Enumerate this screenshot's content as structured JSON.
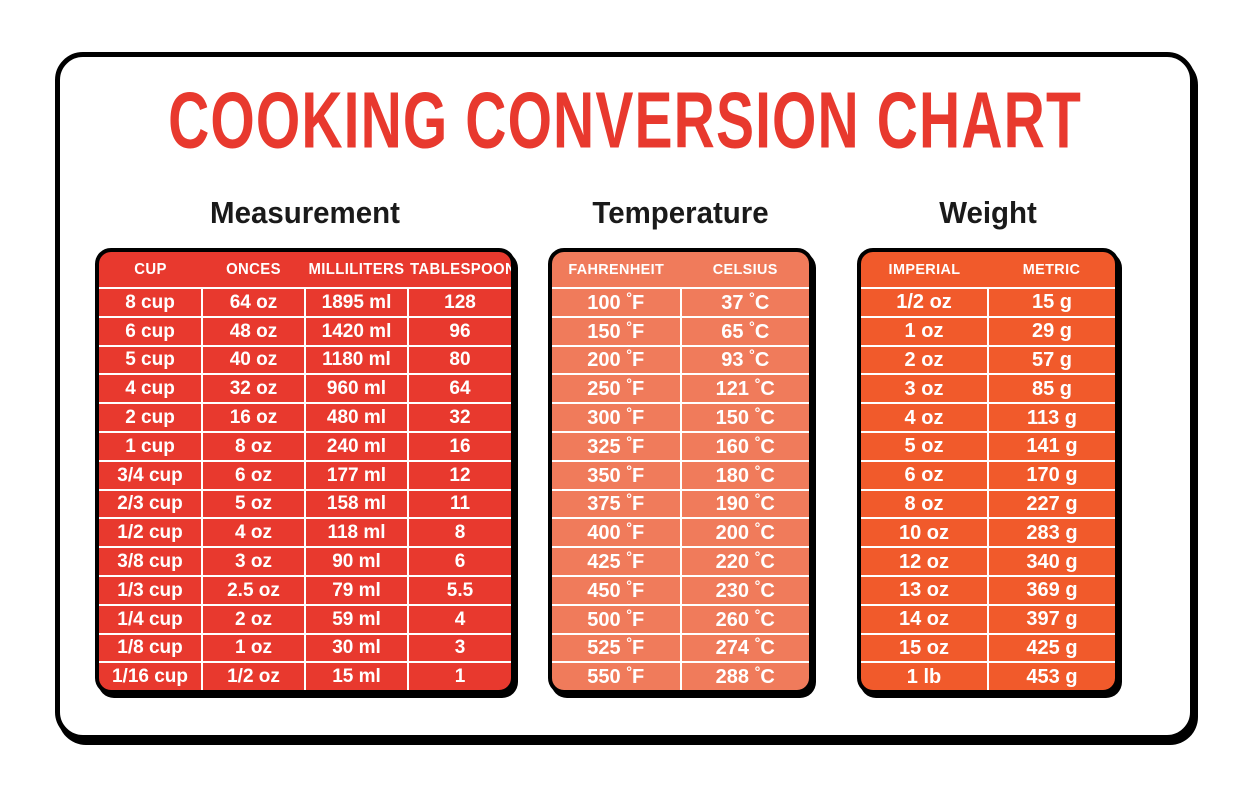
{
  "page": {
    "title": "COOKING CONVERSION CHART",
    "background_color": "#ffffff",
    "border_color": "#000000"
  },
  "colors": {
    "title_red": "#E8392E",
    "measurement_table": "#E8392E",
    "temperature_table": "#F07B5B",
    "weight_table": "#F15A2B",
    "grid_line": "#ffffff",
    "text": "#ffffff",
    "heading_text": "#1a1a1a"
  },
  "sections": {
    "measurement": {
      "heading": "Measurement",
      "columns": [
        "CUP",
        "ONCES",
        "MILLILITERS",
        "TABLESPOONS"
      ],
      "rows": [
        [
          "8 cup",
          "64 oz",
          "1895 ml",
          "128"
        ],
        [
          "6 cup",
          "48 oz",
          "1420 ml",
          "96"
        ],
        [
          "5 cup",
          "40 oz",
          "1180 ml",
          "80"
        ],
        [
          "4 cup",
          "32 oz",
          "960 ml",
          "64"
        ],
        [
          "2 cup",
          "16 oz",
          "480 ml",
          "32"
        ],
        [
          "1 cup",
          "8 oz",
          "240 ml",
          "16"
        ],
        [
          "3/4 cup",
          "6 oz",
          "177 ml",
          "12"
        ],
        [
          "2/3 cup",
          "5 oz",
          "158 ml",
          "11"
        ],
        [
          "1/2 cup",
          "4 oz",
          "118 ml",
          "8"
        ],
        [
          "3/8 cup",
          "3 oz",
          "90 ml",
          "6"
        ],
        [
          "1/3 cup",
          "2.5 oz",
          "79 ml",
          "5.5"
        ],
        [
          "1/4 cup",
          "2 oz",
          "59 ml",
          "4"
        ],
        [
          "1/8 cup",
          "1 oz",
          "30 ml",
          "3"
        ],
        [
          "1/16 cup",
          "1/2 oz",
          "15 ml",
          "1"
        ]
      ]
    },
    "temperature": {
      "heading": "Temperature",
      "columns": [
        "FAHRENHEIT",
        "CELSIUS"
      ],
      "rows": [
        [
          "100 °F",
          "37 °C"
        ],
        [
          "150 °F",
          "65 °C"
        ],
        [
          "200 °F",
          "93 °C"
        ],
        [
          "250 °F",
          "121 °C"
        ],
        [
          "300 °F",
          "150 °C"
        ],
        [
          "325 °F",
          "160 °C"
        ],
        [
          "350 °F",
          "180 °C"
        ],
        [
          "375 °F",
          "190 °C"
        ],
        [
          "400 °F",
          "200 °C"
        ],
        [
          "425 °F",
          "220 °C"
        ],
        [
          "450 °F",
          "230 °C"
        ],
        [
          "500 °F",
          "260 °C"
        ],
        [
          "525 °F",
          "274 °C"
        ],
        [
          "550 °F",
          "288 °C"
        ]
      ]
    },
    "weight": {
      "heading": "Weight",
      "columns": [
        "IMPERIAL",
        "METRIC"
      ],
      "rows": [
        [
          "1/2 oz",
          "15 g"
        ],
        [
          "1 oz",
          "29 g"
        ],
        [
          "2 oz",
          "57 g"
        ],
        [
          "3 oz",
          "85 g"
        ],
        [
          "4 oz",
          "113 g"
        ],
        [
          "5 oz",
          "141 g"
        ],
        [
          "6 oz",
          "170 g"
        ],
        [
          "8 oz",
          "227 g"
        ],
        [
          "10 oz",
          "283 g"
        ],
        [
          "12 oz",
          "340 g"
        ],
        [
          "13 oz",
          "369 g"
        ],
        [
          "14 oz",
          "397 g"
        ],
        [
          "15 oz",
          "425 g"
        ],
        [
          "1 lb",
          "453 g"
        ]
      ]
    }
  }
}
